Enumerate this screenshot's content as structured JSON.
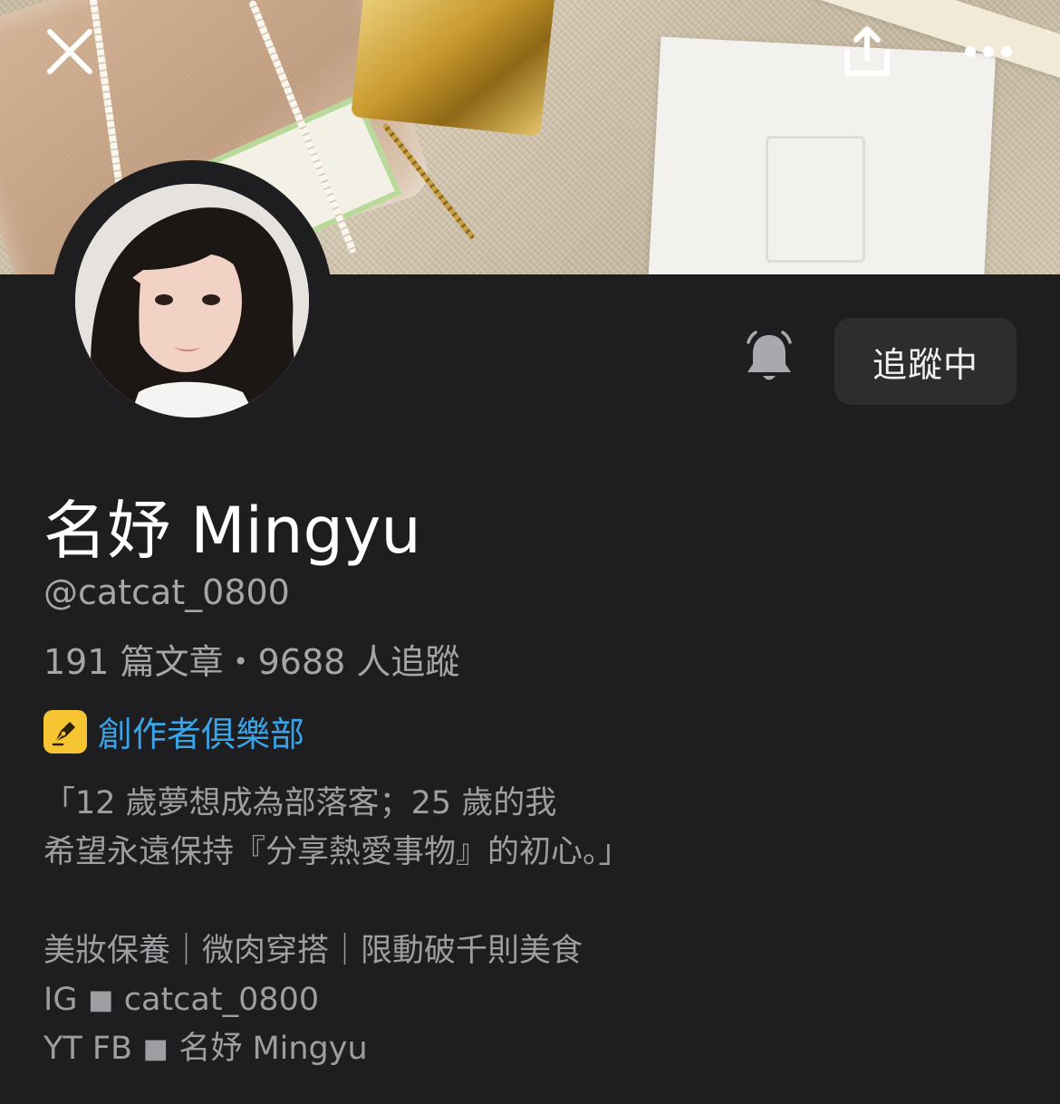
{
  "header": {
    "close_icon": "close-icon",
    "share_icon": "share-icon",
    "more_icon": "more-icon"
  },
  "cover": {
    "description_icons": [
      "perfume-bottle",
      "gold-cap",
      "pearl-chain",
      "card",
      "ribbon"
    ]
  },
  "profile": {
    "name": "名妤 Mingyu",
    "handle": "@catcat_0800",
    "stats": "191 篇文章・9688 人追蹤",
    "club_label": "創作者俱樂部",
    "club_badge_color": "#f6c531",
    "club_text_color": "#3aa4e8"
  },
  "actions": {
    "notify_icon": "bell-icon",
    "follow_label": "追蹤中"
  },
  "bio": {
    "lines": [
      "「12 歲夢想成為部落客；25 歲的我",
      "希望永遠保持『分享熱愛事物』的初心。」",
      "",
      "美妝保養｜微肉穿搭｜限動破千則美食",
      "IG ◼︎ catcat_0800",
      "YT FB ◼︎ 名妤 Mingyu"
    ]
  },
  "theme": {
    "background": "#1e1e20",
    "button_bg": "#2d2d30",
    "text_primary": "#ffffff",
    "text_secondary": "#a6a6aa"
  }
}
